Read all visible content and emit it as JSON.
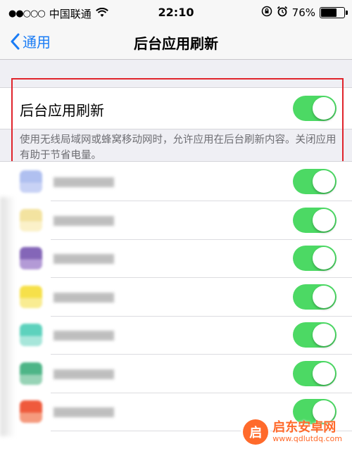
{
  "status_bar": {
    "signal": "●●○○○",
    "carrier": "中国联通",
    "time": "22:10",
    "battery_percent": 76,
    "battery_label": "76%"
  },
  "nav": {
    "back_label": "通用",
    "title": "后台应用刷新"
  },
  "main_setting": {
    "label": "后台应用刷新",
    "enabled": true,
    "footnote": "使用无线局域网或蜂窝移动网时，允许应用在后台刷新内容。关闭应用有助于节省电量。"
  },
  "apps": [
    {
      "icon_colors": [
        "#b0c0f0",
        "#c8d2f5"
      ],
      "enabled": true
    },
    {
      "icon_colors": [
        "#f3e3a0",
        "#fbf1c9"
      ],
      "enabled": true
    },
    {
      "icon_colors": [
        "#8466b8",
        "#b39ad6"
      ],
      "enabled": true
    },
    {
      "icon_colors": [
        "#f6e04a",
        "#f9ec92"
      ],
      "enabled": true
    },
    {
      "icon_colors": [
        "#5dd2bd",
        "#a7e6da"
      ],
      "enabled": true
    },
    {
      "icon_colors": [
        "#4db587",
        "#97d3b6"
      ],
      "enabled": true
    },
    {
      "icon_colors": [
        "#ef5a3c",
        "#f59a7e"
      ],
      "enabled": true
    }
  ],
  "accent_color": "#4cd964",
  "link_color": "#1a7cf5",
  "watermark": {
    "name": "启东安卓网",
    "url": "www.qdlutdq.com"
  }
}
